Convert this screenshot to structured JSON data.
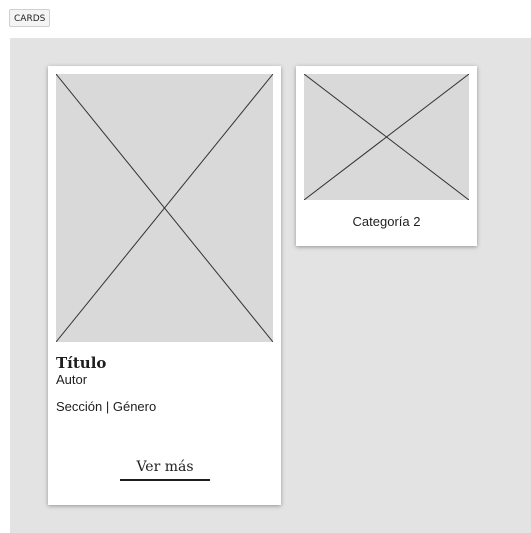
{
  "frame": {
    "label": "CARDS"
  },
  "book_card": {
    "title": "Título",
    "author": "Autor",
    "meta": "Sección | Género",
    "more_label": "Ver más"
  },
  "category_card": {
    "label": "Categoría 2"
  },
  "colors": {
    "canvas_background": "#e3e3e3",
    "card_background": "#ffffff",
    "image_placeholder": "#d9d9d9",
    "text": "#1e1e1e"
  }
}
